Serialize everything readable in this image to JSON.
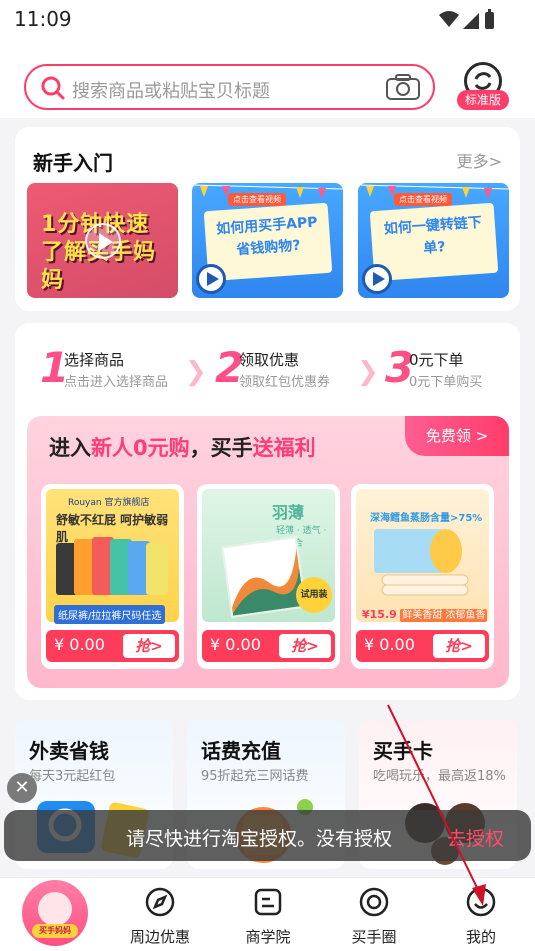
{
  "status_bar": {
    "time": "11:09"
  },
  "search": {
    "placeholder": "搜索商品或粘贴宝贝标题"
  },
  "mode_badge": "标准版",
  "beginner": {
    "title": "新手入门",
    "more": "更多>",
    "videos": [
      {
        "text": "1分钟快速了解买手妈妈"
      },
      {
        "tag": "点击查看视频",
        "text": "如何用买手APP省钱购物?"
      },
      {
        "tag": "点击查看视频",
        "text": "如何一键转链下单?"
      }
    ]
  },
  "steps": [
    {
      "num": "1",
      "title": "选择商品",
      "desc": "点击进入选择商品"
    },
    {
      "num": "2",
      "title": "领取优惠",
      "desc": "领取红包优惠券"
    },
    {
      "num": "3",
      "title": "0元下单",
      "desc": "0元下单购买"
    }
  ],
  "promo": {
    "title_a": "进入",
    "title_hl1": "新人0元购",
    "title_b": "，买手",
    "title_hl2": "送福利",
    "free_button": "免费领 >",
    "products": [
      {
        "brand": "Rouyan 官方旗舰店",
        "title": "舒敏不红屁 呵护敏弱肌",
        "tag": "纸尿裤/拉拉裤尺码任选",
        "price": "¥ 0.00",
        "grab": "抢>"
      },
      {
        "title": "羽薄",
        "subtitle": "轻薄 · 透气 · 超贴合",
        "badge": "试用装",
        "price": "¥ 0.00",
        "grab": "抢>"
      },
      {
        "title": "深海鳕鱼蒸肠含量>75%",
        "deal_price": "¥15.9",
        "label": "鲜美香甜 浓郁鱼香",
        "price": "¥ 0.00",
        "grab": "抢>"
      }
    ]
  },
  "services": [
    {
      "title": "外卖省钱",
      "desc": "每天3元起红包"
    },
    {
      "title": "话费充值",
      "desc": "95折起充三网话费"
    },
    {
      "title": "买手卡",
      "desc": "吃喝玩乐，最高返18%"
    }
  ],
  "toast": {
    "message": "请尽快进行淘宝授权。没有授权",
    "action": "去授权"
  },
  "tabbar": {
    "home_label": "买手妈妈",
    "tabs": [
      {
        "label": "周边优惠",
        "icon": "compass-icon"
      },
      {
        "label": "商学院",
        "icon": "school-icon"
      },
      {
        "label": "买手圈",
        "icon": "circle-gear-icon"
      },
      {
        "label": "我的",
        "icon": "profile-icon"
      }
    ]
  },
  "colors": {
    "accent": "#ff3d6a",
    "pink_light": "#ffd3df",
    "blue": "#2f86ef"
  }
}
